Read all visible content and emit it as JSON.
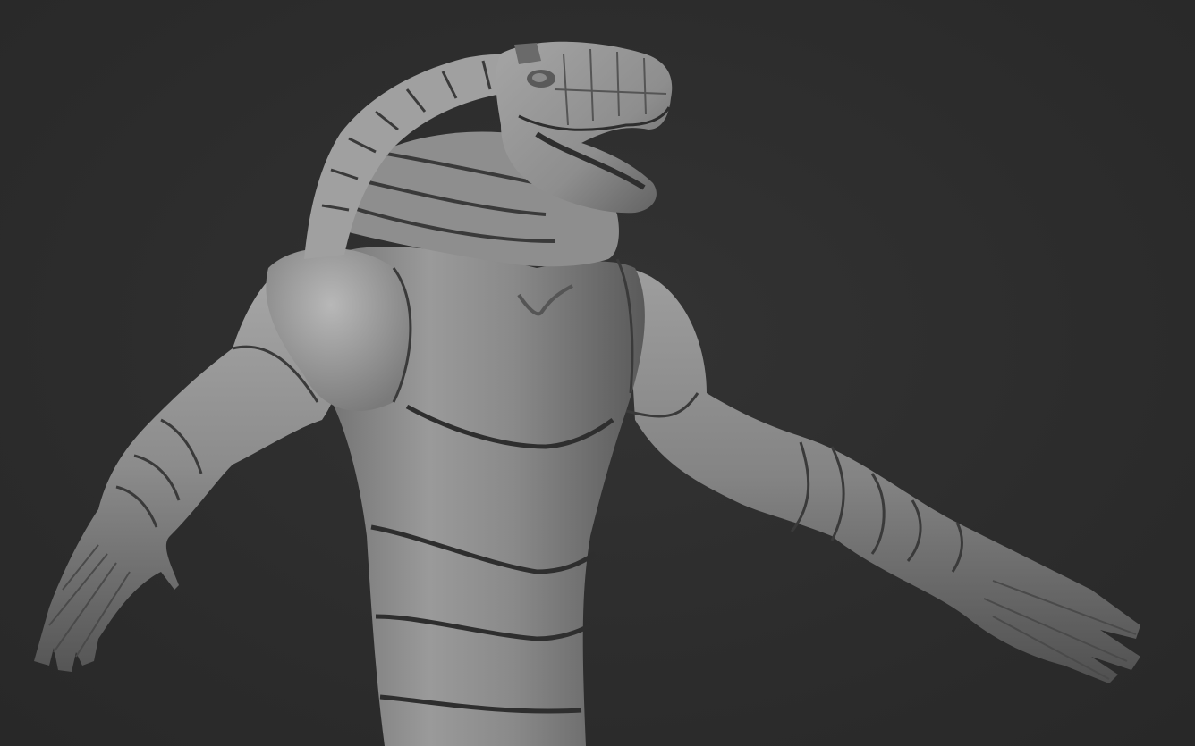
{
  "scene": {
    "subject": "sculpt-model",
    "background_color": "#2c2c2c",
    "material_colors": {
      "highlight": "#b4b4b4",
      "base": "#8c8c8c",
      "shadow": "#4a4a4a",
      "crease": "#2e2e2e"
    }
  }
}
